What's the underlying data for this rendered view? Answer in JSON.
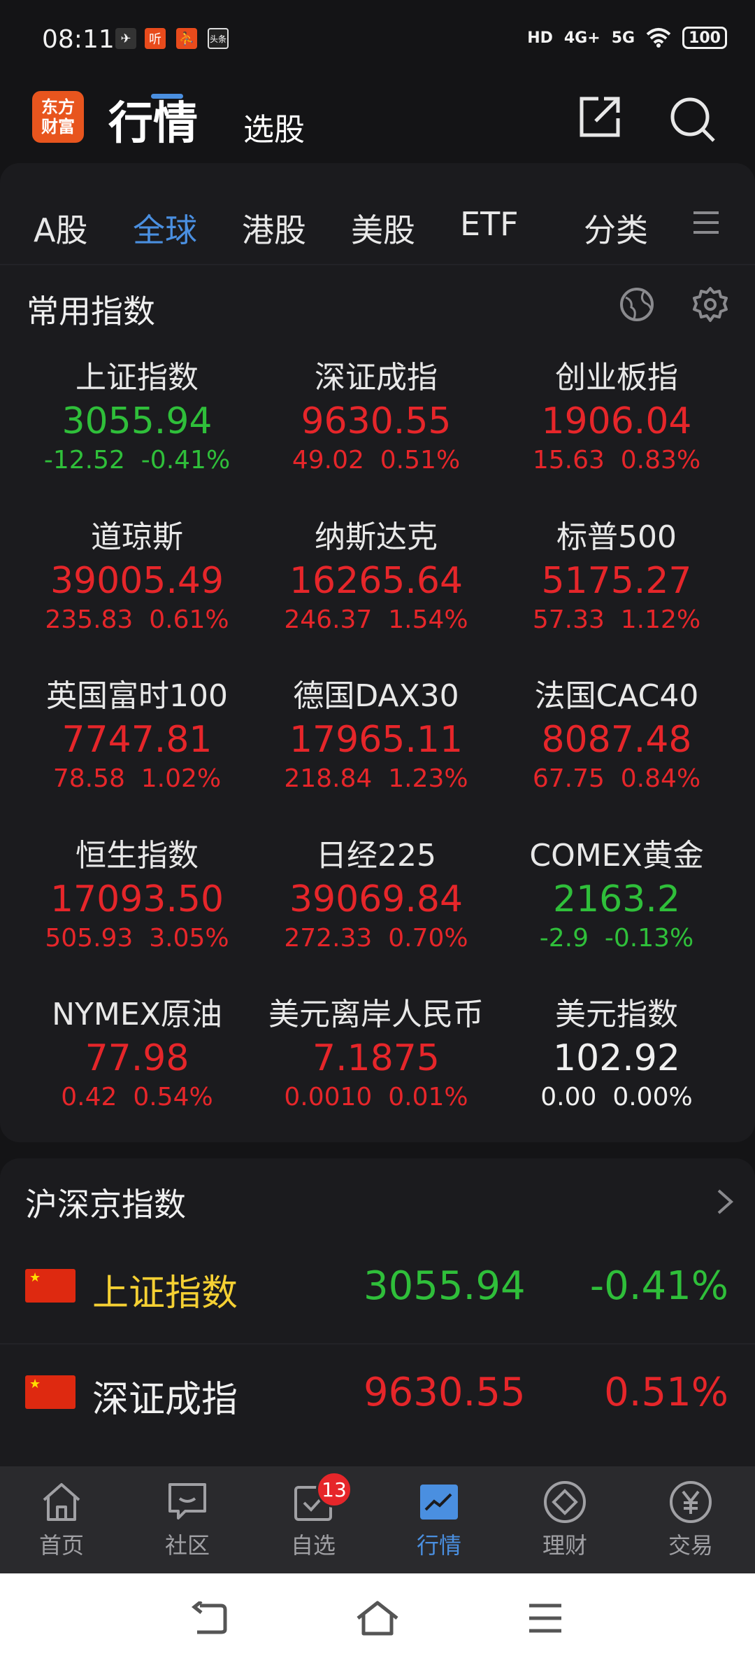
{
  "status_bar": {
    "time": "08:11",
    "app_icons": [
      "听",
      "头条"
    ],
    "signal_labels": [
      "HD",
      "4G+",
      "5G"
    ],
    "battery": "100"
  },
  "header": {
    "logo_text": "东方财富",
    "title": "行情",
    "stock_pick_label": "选股"
  },
  "tabs": [
    {
      "label": "A股",
      "active": false
    },
    {
      "label": "全球",
      "active": true
    },
    {
      "label": "港股",
      "active": false
    },
    {
      "label": "美股",
      "active": false
    },
    {
      "label": "ETF",
      "active": false
    },
    {
      "label": "分类",
      "active": false
    }
  ],
  "common_indices": {
    "title": "常用指数",
    "items": [
      {
        "name": "上证指数",
        "value": "3055.94",
        "change": "-12.52",
        "pct": "-0.41%",
        "trend": "down"
      },
      {
        "name": "深证成指",
        "value": "9630.55",
        "change": "49.02",
        "pct": "0.51%",
        "trend": "up"
      },
      {
        "name": "创业板指",
        "value": "1906.04",
        "change": "15.63",
        "pct": "0.83%",
        "trend": "up"
      },
      {
        "name": "道琼斯",
        "value": "39005.49",
        "change": "235.83",
        "pct": "0.61%",
        "trend": "up"
      },
      {
        "name": "纳斯达克",
        "value": "16265.64",
        "change": "246.37",
        "pct": "1.54%",
        "trend": "up"
      },
      {
        "name": "标普500",
        "value": "5175.27",
        "change": "57.33",
        "pct": "1.12%",
        "trend": "up"
      },
      {
        "name": "英国富时100",
        "value": "7747.81",
        "change": "78.58",
        "pct": "1.02%",
        "trend": "up"
      },
      {
        "name": "德国DAX30",
        "value": "17965.11",
        "change": "218.84",
        "pct": "1.23%",
        "trend": "up"
      },
      {
        "name": "法国CAC40",
        "value": "8087.48",
        "change": "67.75",
        "pct": "0.84%",
        "trend": "up"
      },
      {
        "name": "恒生指数",
        "value": "17093.50",
        "change": "505.93",
        "pct": "3.05%",
        "trend": "up"
      },
      {
        "name": "日经225",
        "value": "39069.84",
        "change": "272.33",
        "pct": "0.70%",
        "trend": "up"
      },
      {
        "name": "COMEX黄金",
        "value": "2163.2",
        "change": "-2.9",
        "pct": "-0.13%",
        "trend": "down"
      },
      {
        "name": "NYMEX原油",
        "value": "77.98",
        "change": "0.42",
        "pct": "0.54%",
        "trend": "up"
      },
      {
        "name": "美元离岸人民币",
        "value": "7.1875",
        "change": "0.0010",
        "pct": "0.01%",
        "trend": "up"
      },
      {
        "name": "美元指数",
        "value": "102.92",
        "change": "0.00",
        "pct": "0.00%",
        "trend": "flat"
      }
    ]
  },
  "hs_indices": {
    "title": "沪深京指数",
    "rows": [
      {
        "name": "上证指数",
        "value": "3055.94",
        "pct": "-0.41%",
        "trend": "down",
        "name_color": "#f5d033"
      },
      {
        "name": "深证成指",
        "value": "9630.55",
        "pct": "0.51%",
        "trend": "up",
        "name_color": "#f0f0f0"
      }
    ]
  },
  "bottom_nav": {
    "items": [
      {
        "label": "首页",
        "icon": "home-icon",
        "active": false
      },
      {
        "label": "社区",
        "icon": "community-icon",
        "active": false
      },
      {
        "label": "自选",
        "icon": "watchlist-icon",
        "active": false
      },
      {
        "label": "行情",
        "icon": "market-icon",
        "active": true
      },
      {
        "label": "理财",
        "icon": "wealth-icon",
        "active": false
      },
      {
        "label": "交易",
        "icon": "trade-icon",
        "active": false
      }
    ],
    "badge_count": "13"
  },
  "colors": {
    "up": "#e6262a",
    "down": "#2fbf3a",
    "flat": "#f0f0f0",
    "accent": "#4a8fe0",
    "brand": "#e8551e"
  }
}
